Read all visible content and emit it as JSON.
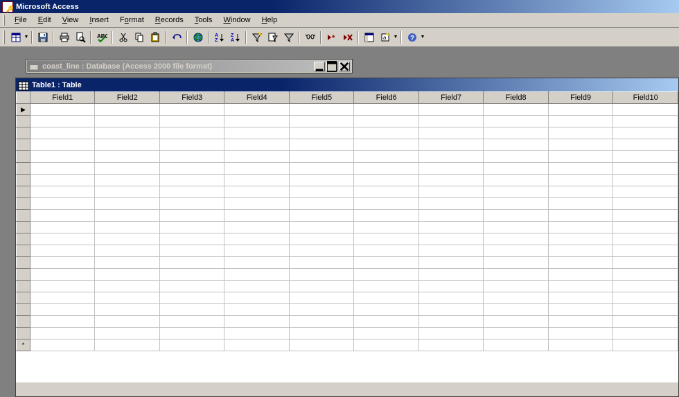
{
  "app_title": "Microsoft Access",
  "menu": [
    {
      "label": "File",
      "u": "F"
    },
    {
      "label": "Edit",
      "u": "E"
    },
    {
      "label": "View",
      "u": "V"
    },
    {
      "label": "Insert",
      "u": "I"
    },
    {
      "label": "Format",
      "u": "o"
    },
    {
      "label": "Records",
      "u": "R"
    },
    {
      "label": "Tools",
      "u": "T"
    },
    {
      "label": "Window",
      "u": "W"
    },
    {
      "label": "Help",
      "u": "H"
    }
  ],
  "db_window_title": "coast_line : Database (Access 2000 file format)",
  "table_window_title": "Table1 : Table",
  "columns": [
    "Field1",
    "Field2",
    "Field3",
    "Field4",
    "Field5",
    "Field6",
    "Field7",
    "Field8",
    "Field9",
    "Field10"
  ],
  "row_count": 21,
  "current_row_marker": "▶",
  "new_row_marker": "*"
}
